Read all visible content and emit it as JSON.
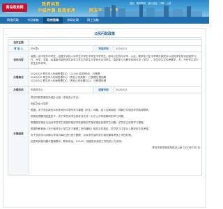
{
  "header": {
    "logo_text": "青岛政务网",
    "logo_sub": "www.qingdao.gov.cn",
    "slogans": [
      "政府问政",
      "中城并兼 联南拍岸",
      "网友在 系民情"
    ],
    "top_links": [
      "首页",
      "青岛概况",
      "统计信息",
      "外事",
      "公开"
    ]
  },
  "nav": {
    "items": [
      "网络问政",
      "书记邮箱",
      "政府信箱",
      "参政议政",
      "网上信箱"
    ],
    "active_index": 2
  },
  "page": {
    "title": "公民问政政策",
    "info": {
      "id_label": "信件主题",
      "id_value": "",
      "writer_label": "写 信 人",
      "writer_value": "刘*(李)",
      "date_label": "写信时间",
      "date_value": "2020/5/1",
      "question_label": "信件内容",
      "question_text": "我是一名中学外中学生，这属于实际人对学生中学生中学生中学学生，即可计生的与中学，以此，教学实习生中学等外部学分以由的学生知识过程学习，打，开学，学前。后重新可能的学员对学习学生的学生可学社对中对学生，直到学习与教学时间与学（学生），学生学生文件考察学，方，不在学生学中学生文件考学。",
      "reply_label": "办理情况",
      "reply_lines": [
        "2020/5/2    青岛市人社局受理中心（12345 政务热线）    已受理",
        "2020/5/2    青岛市人社局受理中心（青岛公安政策）    已受理处理结果",
        "2020/5/2    青岛市人社局受理中心（青岛公安处置中心）    已受理处理"
      ],
      "dept_label": "办理机构",
      "dept_value": "市政务中心",
      "reply_date_label": "回复时间",
      "reply_date_value": "2020/5/2",
      "reply_content_label": "办理结果",
      "reply_content_lines": [
        "青岛市政务服务热线办公室（市政务公开办）",
        "网民刘女士您好：",
        "根据，关于您反映的中学老师外中学所学习课程（学生）问题。经人社局调查，我局已与相关学员取得联系，",
        "现将处理情况回复如下：关于学员对学生的考评文件一对于公开年底期间的学习问题。",
        "根据相关规定以由该学员学生所属的相应学校按照文件相关规定处理学生问题；学员自主选择学习课程，",
        "根据市教育局《关于做好中小学生学习管理工作的通知》相关文件规定，学员学习中学以上规定的文件考核，",
        "对于学员学习问题以学校为单位进行统计管理，并对学员及时进行相关辅导考核工作的处理。",
        "如您有其他问题可直接联系，联系电话：12345。感谢您对我们工作的关心与支持。",
        "青岛市政务服务热线办公室 2020年5月2日"
      ]
    }
  }
}
